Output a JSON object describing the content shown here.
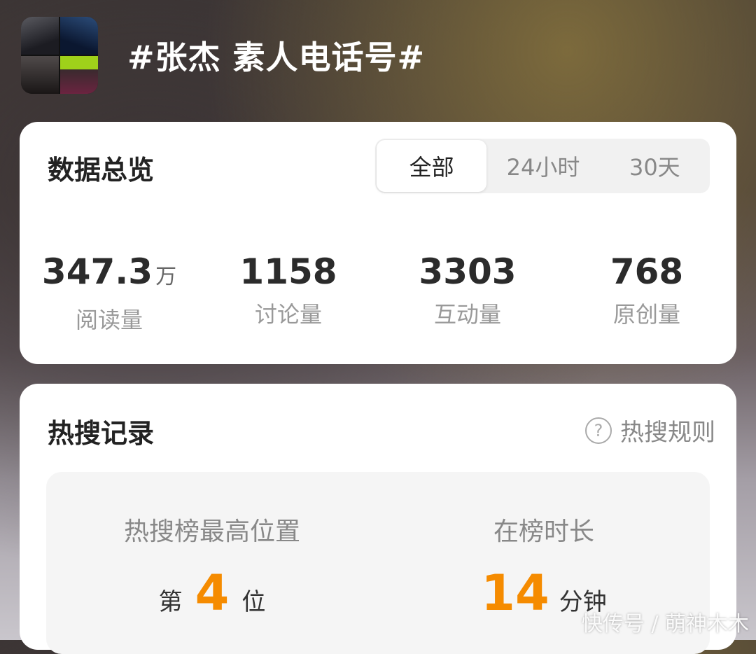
{
  "topic": {
    "title": "#张杰 素人电话号#"
  },
  "overview": {
    "title": "数据总览",
    "tabs": [
      "全部",
      "24小时",
      "30天"
    ],
    "active_tab": "全部",
    "stats": [
      {
        "value": "347.3",
        "unit": "万",
        "label": "阅读量"
      },
      {
        "value": "1158",
        "unit": "",
        "label": "讨论量"
      },
      {
        "value": "3303",
        "unit": "",
        "label": "互动量"
      },
      {
        "value": "768",
        "unit": "",
        "label": "原创量"
      }
    ]
  },
  "hot_search": {
    "title": "热搜记录",
    "rules_label": "热搜规则",
    "help_icon_glyph": "?",
    "peak_position": {
      "label": "热搜榜最高位置",
      "prefix": "第",
      "value": "4",
      "suffix": "位"
    },
    "duration": {
      "label": "在榜时长",
      "value": "14",
      "unit": "分钟"
    }
  },
  "watermark": "快传号 / 萌神木木",
  "colors": {
    "accent": "#f58b00",
    "card": "#ffffff"
  }
}
